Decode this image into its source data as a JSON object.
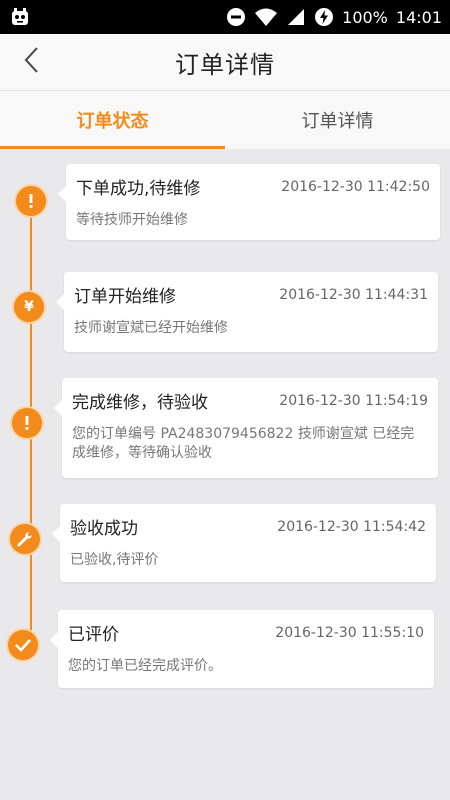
{
  "status_bar": {
    "battery": "100%",
    "time": "14:01"
  },
  "header": {
    "title": "订单详情"
  },
  "tabs": [
    {
      "label": "订单状态",
      "active": true
    },
    {
      "label": "订单详情",
      "active": false
    }
  ],
  "accent_color": "#f28b1b",
  "timeline": [
    {
      "icon": "exclamation-icon",
      "title": "下单成功,待维修",
      "time": "2016-12-30 11:42:50",
      "desc": "等待技师开始维修"
    },
    {
      "icon": "yen-icon",
      "title": "订单开始维修",
      "time": "2016-12-30 11:44:31",
      "desc": "技师谢宣斌已经开始维修"
    },
    {
      "icon": "exclamation-icon",
      "title": "完成维修，待验收",
      "time": "2016-12-30 11:54:19",
      "desc": "您的订单编号 PA2483079456822 技师谢宣斌 已经完成维修，等待确认验收"
    },
    {
      "icon": "wrench-icon",
      "title": "验收成功",
      "time": "2016-12-30 11:54:42",
      "desc": "已验收,待评价"
    },
    {
      "icon": "check-icon",
      "title": "已评价",
      "time": "2016-12-30 11:55:10",
      "desc": "您的订单已经完成评价。"
    }
  ]
}
